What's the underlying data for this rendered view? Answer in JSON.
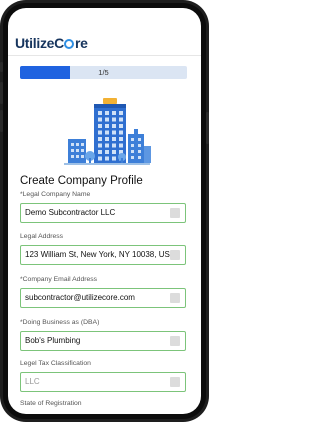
{
  "app": {
    "logo_text_1": "UtilizeC",
    "logo_text_2": "re"
  },
  "progress": {
    "label": "1/5",
    "fraction": 0.3
  },
  "page": {
    "title": "Create Company Profile"
  },
  "fields": [
    {
      "label": "*Legal Company Name",
      "value": "Demo Subcontractor LLC"
    },
    {
      "label": "Legal Address",
      "value": "123 William St, New York, NY 10038, US"
    },
    {
      "label": "*Company Email Address",
      "value": "subcontractor@utilizecore.com"
    },
    {
      "label": "*Doing Business as (DBA)",
      "value": "Bob's Plumbing"
    },
    {
      "label": "Legel Tax Classification",
      "value": "LLC"
    },
    {
      "label": "State of Registration",
      "value": ""
    }
  ],
  "colors": {
    "brand": "#17355e",
    "accent": "#1f63e0",
    "field_border": "#7cc47a"
  }
}
